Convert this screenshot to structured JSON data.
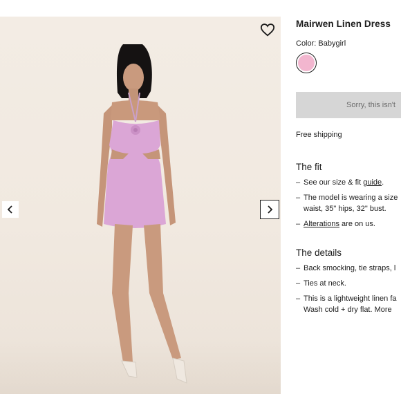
{
  "product": {
    "title": "Mairwen Linen Dress",
    "color_label": "Color:",
    "color_value": "Babygirl",
    "swatch_color": "#f2b6cf",
    "soldout_button": "Sorry, this isn't",
    "shipping": "Free shipping"
  },
  "fit": {
    "heading": "The fit",
    "item1_pre": "See our size & fit ",
    "item1_link": "guide",
    "item1_post": ".",
    "item2_line1": "The model is wearing a size",
    "item2_line2": "waist, 35\" hips, 32\" bust.",
    "item3_link": "Alterations",
    "item3_post": " are on us."
  },
  "details": {
    "heading": "The details",
    "item1": "Back smocking, tie straps, l",
    "item2": "Ties at neck.",
    "item3_line1": "This is a lightweight linen fa",
    "item3_line2": "Wash cold + dry flat. More"
  },
  "gallery": {
    "wishlist_icon": "heart-icon",
    "prev_icon": "chevron-left-icon",
    "next_icon": "chevron-right-icon"
  },
  "dash": "–"
}
